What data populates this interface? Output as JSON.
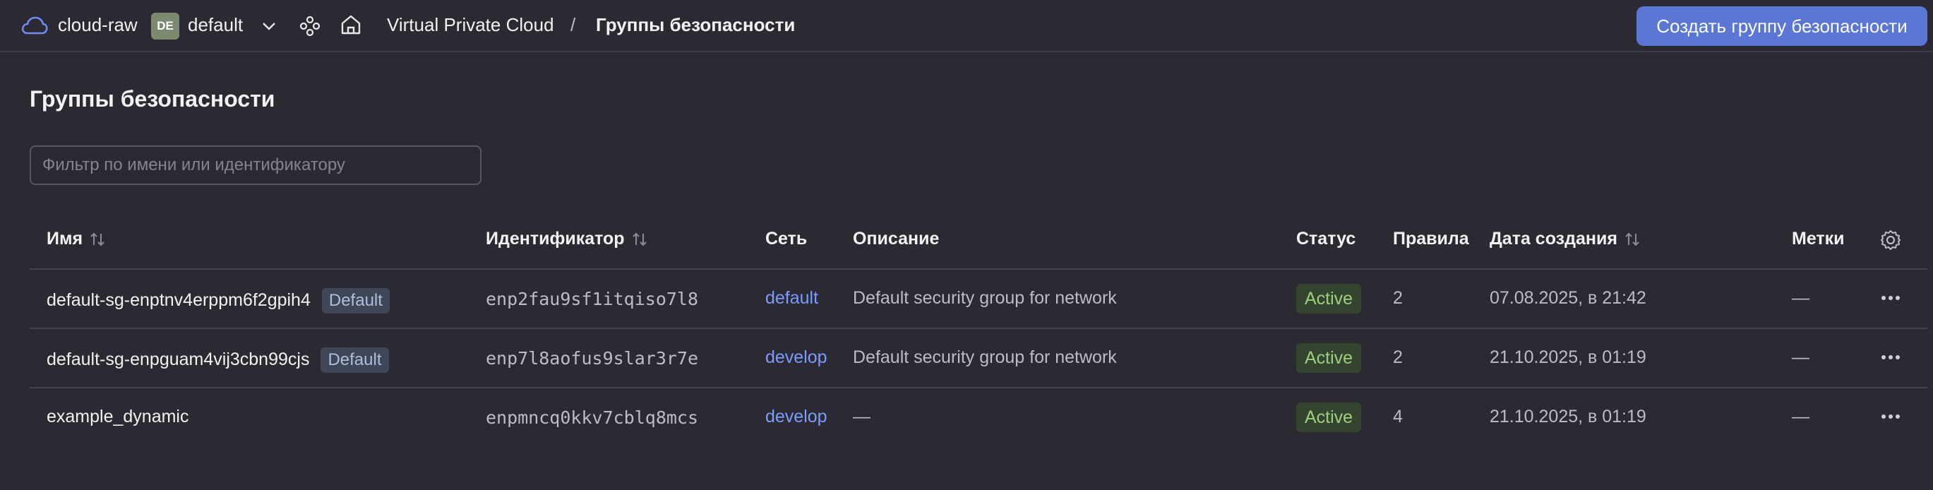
{
  "topbar": {
    "cloud_name": "cloud-raw",
    "folder_badge": "DE",
    "folder_name": "default",
    "breadcrumb_service": "Virtual Private Cloud",
    "breadcrumb_separator": "/",
    "breadcrumb_current": "Группы безопасности",
    "create_button": "Создать группу безопасности"
  },
  "page": {
    "title": "Группы безопасности",
    "filter_placeholder": "Фильтр по имени или идентификатору"
  },
  "table": {
    "columns": {
      "name": "Имя",
      "id": "Идентификатор",
      "network": "Сеть",
      "description": "Описание",
      "status": "Статус",
      "rules": "Правила",
      "created": "Дата создания",
      "labels": "Метки"
    },
    "rows": [
      {
        "name": "default-sg-enptnv4erppm6f2gpih4",
        "tag": "Default",
        "id": "enp2fau9sf1itqiso7l8",
        "network": "default",
        "description": "Default security group for network",
        "status": "Active",
        "rules": "2",
        "created": "07.08.2025, в 21:42",
        "labels": "—"
      },
      {
        "name": "default-sg-enpguam4vij3cbn99cjs",
        "tag": "Default",
        "id": "enp7l8aofus9slar3r7e",
        "network": "develop",
        "description": "Default security group for network",
        "status": "Active",
        "rules": "2",
        "created": "21.10.2025, в 01:19",
        "labels": "—"
      },
      {
        "name": "example_dynamic",
        "tag": "",
        "id": "enpmncq0kkv7cblq8mcs",
        "network": "develop",
        "description": "—",
        "status": "Active",
        "rules": "4",
        "created": "21.10.2025, в 01:19",
        "labels": "—"
      }
    ]
  },
  "colors": {
    "background": "#2b2a32",
    "accent": "#5a77d6",
    "link": "#7b9bff",
    "status_active_bg": "#35442f",
    "status_active_text": "#9bd07e"
  },
  "icons": [
    "cloud-icon",
    "chevron-down-icon",
    "nodes-icon",
    "home-icon",
    "sort-icon",
    "gear-icon",
    "more-dots-icon"
  ]
}
